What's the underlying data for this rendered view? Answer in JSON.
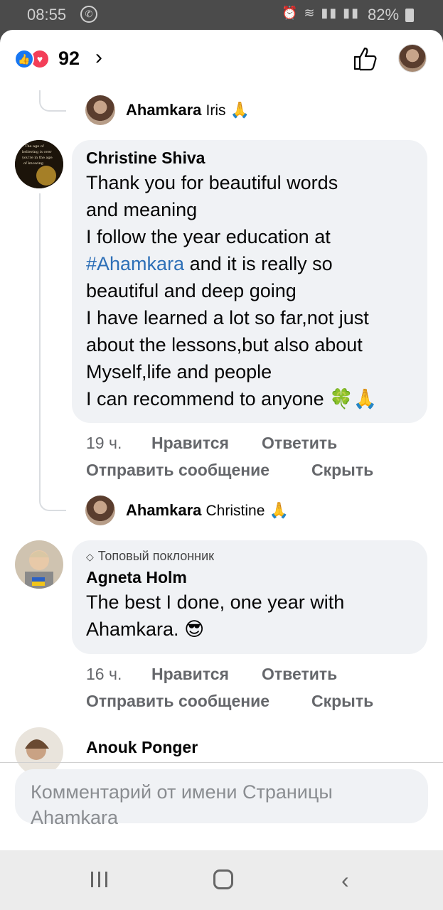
{
  "status_bar": {
    "time": "08:55",
    "battery": "82%",
    "app_icon": "whatsapp-icon",
    "signal_icons": "⏰ ≋ ▮▮ ▮▮"
  },
  "header": {
    "reaction_count": "92",
    "chevron": "›",
    "like_icon": "thumbs-up-outline-icon"
  },
  "reply_iris": {
    "author": "Ahamkara",
    "text": "Iris",
    "emoji": "🙏"
  },
  "comment_christine": {
    "author": "Christine Shiva",
    "text_before": "Thank you for beautiful words\nand meaning\nI follow the year education at\n",
    "hashtag": "#Ahamkara",
    "text_after": " and it is really so\nbeautiful and deep going\nI have learned a lot so far,not just\nabout the lessons,but also about\nMyself,life and people\nI can recommend to anyone",
    "emoji": "🍀🙏",
    "time": "19 ч.",
    "like": "Нравится",
    "reply": "Ответить",
    "message": "Отправить сообщение",
    "hide": "Скрыть"
  },
  "reply_christine": {
    "author": "Ahamkara",
    "text": "Christine",
    "emoji": "🙏"
  },
  "comment_agneta": {
    "badge": "Топовый поклонник",
    "author": "Agneta Holm",
    "text": "The best I done, one year with\nAhamkara.",
    "emoji": "😎",
    "time": "16 ч.",
    "like": "Нравится",
    "reply": "Ответить",
    "message": "Отправить сообщение",
    "hide": "Скрыть"
  },
  "comment_anouk": {
    "author": "Anouk Ponger"
  },
  "composer": {
    "placeholder": "Комментарий от имени Страницы\nAhamkara"
  }
}
